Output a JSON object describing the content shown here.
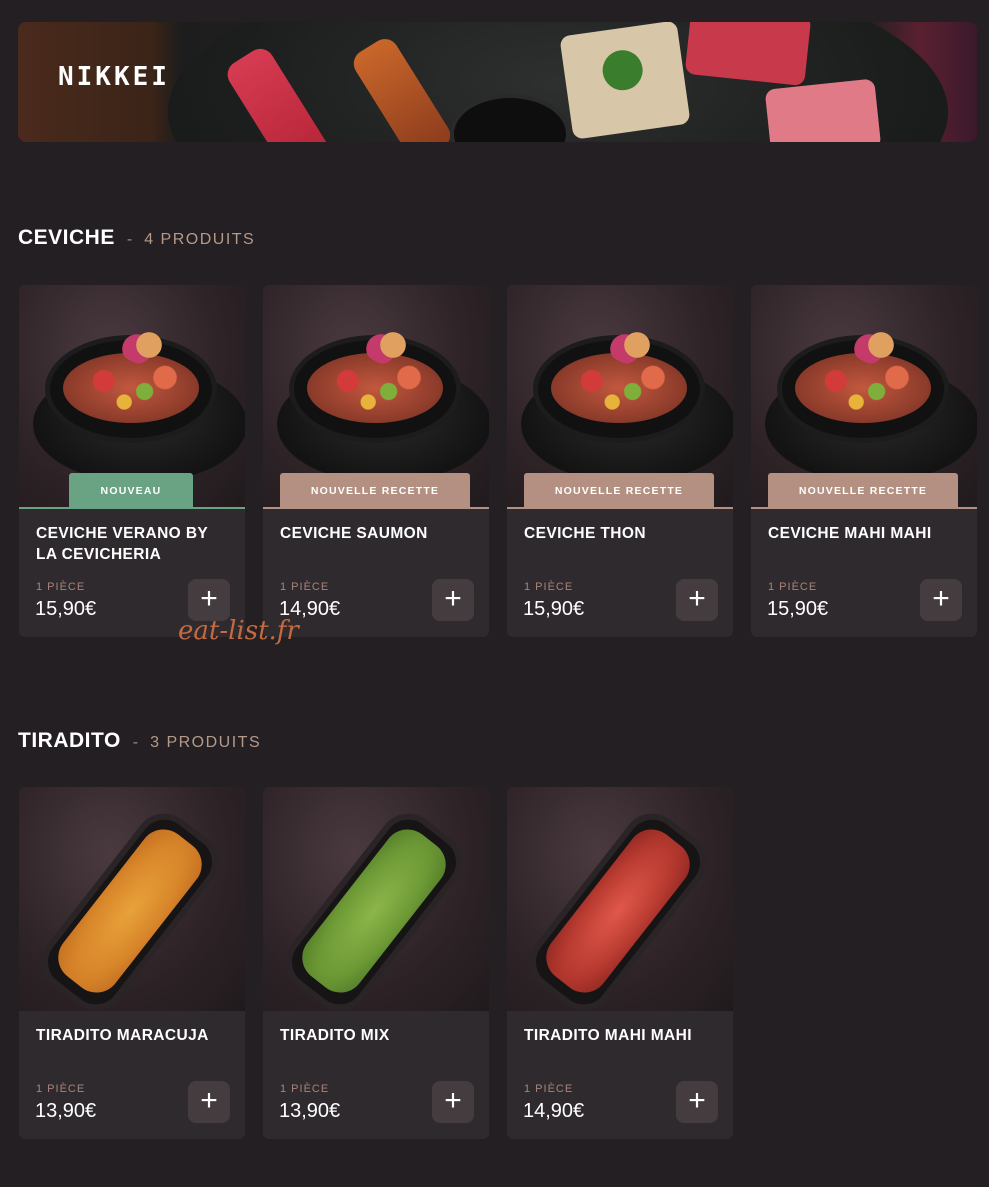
{
  "banner": {
    "logo": "NIKKEI"
  },
  "colors": {
    "background": "#231f22",
    "card": "#2f2a2d",
    "badge_new": "#6aa384",
    "badge_recipe": "#b39082",
    "accent": "#b59a8a"
  },
  "sections": [
    {
      "title": "CEVICHE",
      "dash": "-",
      "count": "4 PRODUITS",
      "products": [
        {
          "name": "CEVICHE VERANO BY LA CEVICHERIA",
          "badge": "NOUVEAU",
          "unit": "1 PIÈCE",
          "price": "15,90€",
          "add": "+"
        },
        {
          "name": "CEVICHE SAUMON",
          "badge": "NOUVELLE RECETTE",
          "unit": "1 PIÈCE",
          "price": "14,90€",
          "add": "+"
        },
        {
          "name": "CEVICHE THON",
          "badge": "NOUVELLE RECETTE",
          "unit": "1 PIÈCE",
          "price": "15,90€",
          "add": "+"
        },
        {
          "name": "CEVICHE MAHI MAHI",
          "badge": "NOUVELLE RECETTE",
          "unit": "1 PIÈCE",
          "price": "15,90€",
          "add": "+"
        }
      ]
    },
    {
      "title": "TIRADITO",
      "dash": "-",
      "count": "3 PRODUITS",
      "products": [
        {
          "name": "TIRADITO MARACUJA",
          "unit": "1 PIÈCE",
          "price": "13,90€",
          "add": "+"
        },
        {
          "name": "TIRADITO MIX",
          "unit": "1 PIÈCE",
          "price": "13,90€",
          "add": "+"
        },
        {
          "name": "TIRADITO MAHI MAHI",
          "unit": "1 PIÈCE",
          "price": "14,90€",
          "add": "+"
        }
      ]
    }
  ],
  "watermark": "eat-list.fr"
}
